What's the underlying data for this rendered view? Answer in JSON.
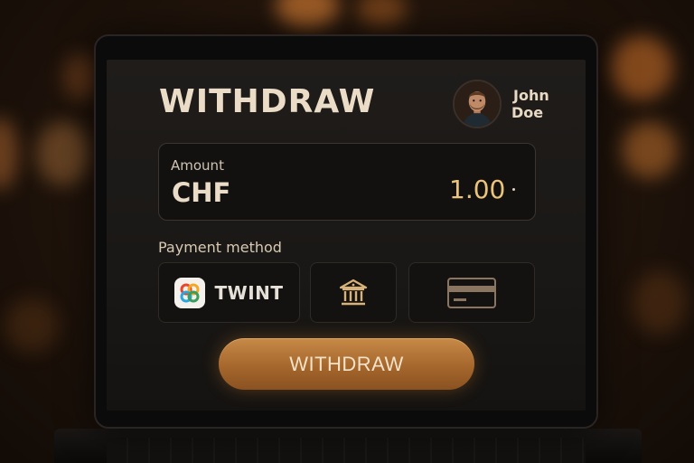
{
  "header": {
    "title": "WITHDRAW"
  },
  "user": {
    "first_name": "John",
    "last_name": "Doe",
    "avatar_icon": "user-avatar"
  },
  "amount": {
    "label": "Amount",
    "currency": "CHF",
    "value": "1.00"
  },
  "payment": {
    "label": "Payment method",
    "methods": [
      {
        "name": "TWINT",
        "icon": "twint-logo-icon"
      },
      {
        "name": "",
        "icon": "bank-icon"
      },
      {
        "name": "",
        "icon": "credit-card-icon"
      }
    ]
  },
  "actions": {
    "withdraw_label": "WITHDRAW"
  },
  "colors": {
    "accent": "#b5753a",
    "value_gold": "#e9c47a",
    "text_light": "#eadcc6",
    "panel": "#131110"
  }
}
